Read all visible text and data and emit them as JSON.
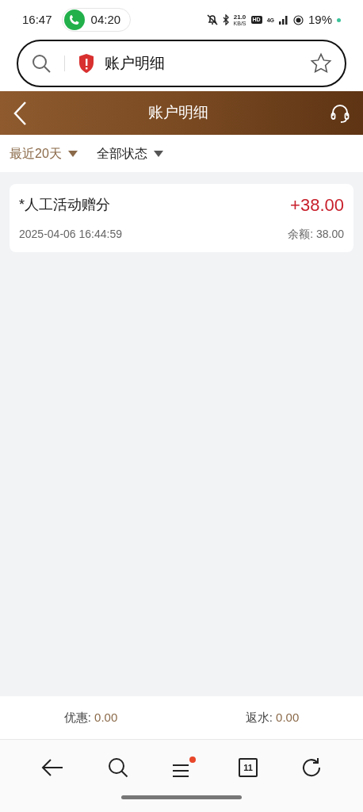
{
  "status_bar": {
    "time": "16:47",
    "call_timer": "04:20",
    "net_speed": "21.0",
    "net_unit": "KB/S",
    "hd": "HD",
    "network": "4G",
    "battery": "19%"
  },
  "address_bar": {
    "title": "账户明细"
  },
  "header": {
    "title": "账户明细"
  },
  "filters": [
    {
      "label": "最近20天",
      "selected": true
    },
    {
      "label": "全部状态",
      "selected": false
    }
  ],
  "records": [
    {
      "title": "*人工活动赠分",
      "amount": "+38.00",
      "time": "2025-04-06 16:44:59",
      "balance_label": "余额:",
      "balance": "38.00"
    }
  ],
  "summary": [
    {
      "label": "优惠:",
      "value": "0.00"
    },
    {
      "label": "返水:",
      "value": "0.00"
    }
  ],
  "browser_nav": {
    "tab_count": "11",
    "menu_dot": true
  }
}
